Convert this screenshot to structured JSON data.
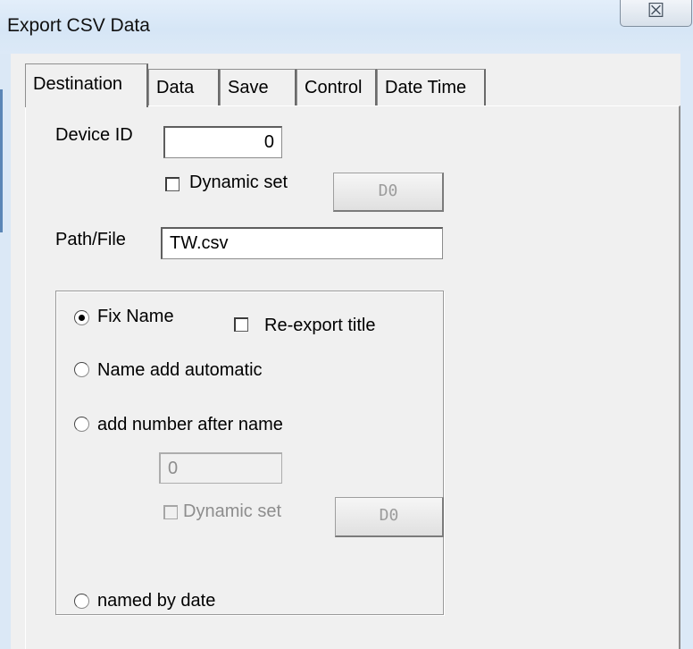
{
  "window": {
    "title": "Export CSV Data",
    "close_glyph": "☒"
  },
  "tabs": [
    {
      "label": "Destination",
      "active": true
    },
    {
      "label": "Data",
      "active": false
    },
    {
      "label": "Save",
      "active": false
    },
    {
      "label": "Control",
      "active": false
    },
    {
      "label": "Date Time",
      "active": false
    }
  ],
  "destination": {
    "device_id_label": "Device ID",
    "device_id_value": "0",
    "device_dynamic_label": "Dynamic set",
    "device_dynamic_checked": false,
    "device_dynamic_button": "D0",
    "path_label": "Path/File",
    "path_value": "TW.csv",
    "options": {
      "fix_name": {
        "label": "Fix Name",
        "selected": true
      },
      "reexport_title": {
        "label": "Re-export title",
        "checked": false
      },
      "name_add_automatic": {
        "label": "Name add automatic",
        "selected": false
      },
      "add_number_after_name": {
        "label": "add number after name",
        "selected": false
      },
      "number_value": "0",
      "number_dynamic_label": "Dynamic set",
      "number_dynamic_checked": false,
      "number_dynamic_button": "D0",
      "named_by_date": {
        "label": "named by date",
        "selected": false
      }
    }
  }
}
